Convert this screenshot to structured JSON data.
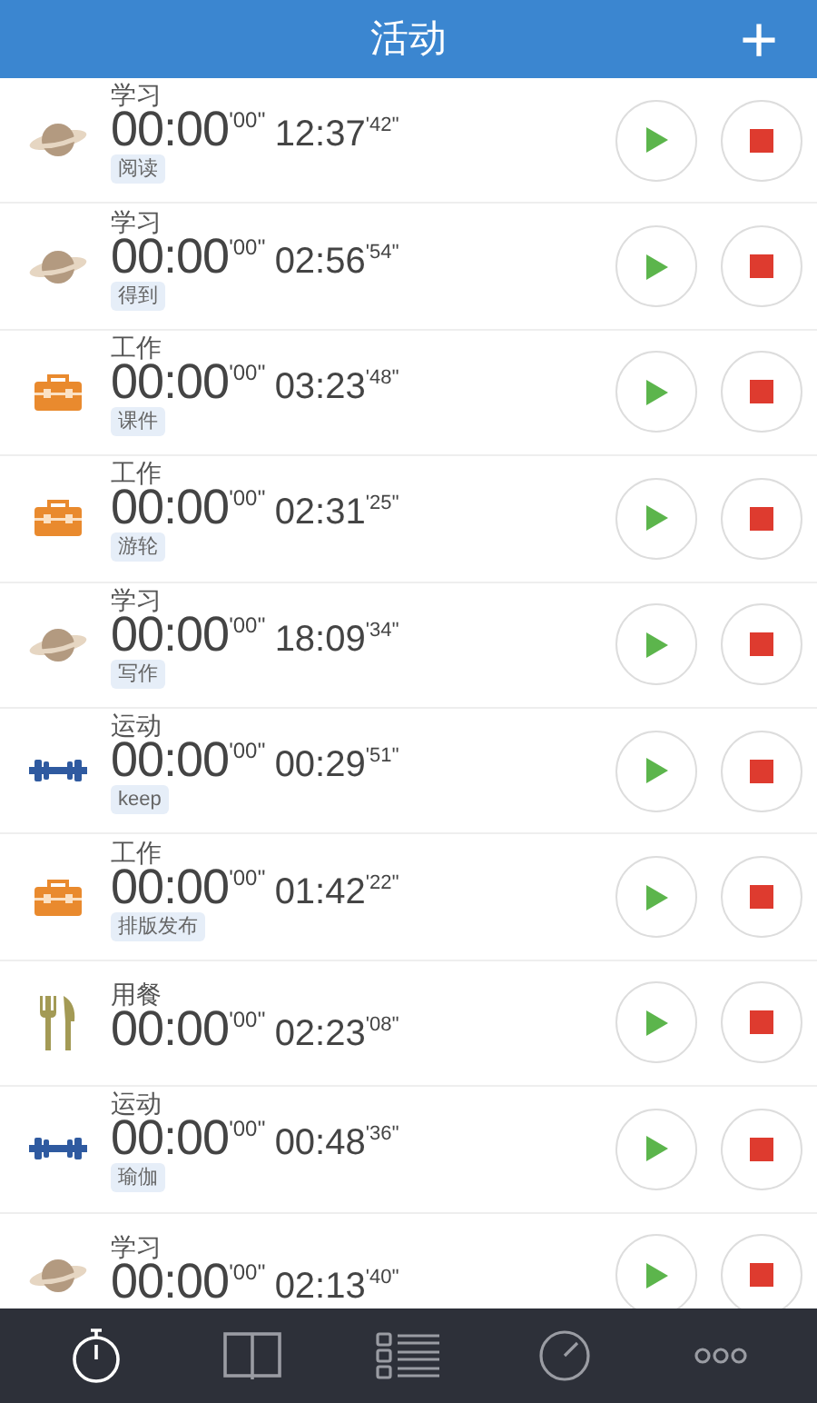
{
  "header": {
    "title": "活动",
    "add_label": "+"
  },
  "activities": [
    {
      "kind": "planet",
      "category": "学习",
      "elapsed": "00:00",
      "elapsed_seconds": "'00''",
      "total": "12:37",
      "total_seconds": "'42''",
      "tag": "阅读"
    },
    {
      "kind": "planet",
      "category": "学习",
      "elapsed": "00:00",
      "elapsed_seconds": "'00''",
      "total": "02:56",
      "total_seconds": "'54''",
      "tag": "得到"
    },
    {
      "kind": "toolbox",
      "category": "工作",
      "elapsed": "00:00",
      "elapsed_seconds": "'00''",
      "total": "03:23",
      "total_seconds": "'48''",
      "tag": "课件"
    },
    {
      "kind": "toolbox",
      "category": "工作",
      "elapsed": "00:00",
      "elapsed_seconds": "'00''",
      "total": "02:31",
      "total_seconds": "'25''",
      "tag": "游轮"
    },
    {
      "kind": "planet",
      "category": "学习",
      "elapsed": "00:00",
      "elapsed_seconds": "'00''",
      "total": "18:09",
      "total_seconds": "'34''",
      "tag": "写作"
    },
    {
      "kind": "dumbbell",
      "category": "运动",
      "elapsed": "00:00",
      "elapsed_seconds": "'00''",
      "total": "00:29",
      "total_seconds": "'51''",
      "tag": "keep"
    },
    {
      "kind": "toolbox",
      "category": "工作",
      "elapsed": "00:00",
      "elapsed_seconds": "'00''",
      "total": "01:42",
      "total_seconds": "'22''",
      "tag": "排版发布"
    },
    {
      "kind": "utensils",
      "category": "用餐",
      "elapsed": "00:00",
      "elapsed_seconds": "'00''",
      "total": "02:23",
      "total_seconds": "'08''"
    },
    {
      "kind": "dumbbell",
      "category": "运动",
      "elapsed": "00:00",
      "elapsed_seconds": "'00''",
      "total": "00:48",
      "total_seconds": "'36''",
      "tag": "瑜伽"
    },
    {
      "kind": "planet",
      "category": "学习",
      "elapsed": "00:00",
      "elapsed_seconds": "'00''",
      "total": "02:13",
      "total_seconds": "'40''"
    }
  ],
  "tab_bar": [
    {
      "kind": "stopwatch",
      "selected": true
    },
    {
      "kind": "book",
      "selected": false
    },
    {
      "kind": "list",
      "selected": false
    },
    {
      "kind": "clock",
      "selected": false
    },
    {
      "kind": "more",
      "selected": false
    }
  ]
}
